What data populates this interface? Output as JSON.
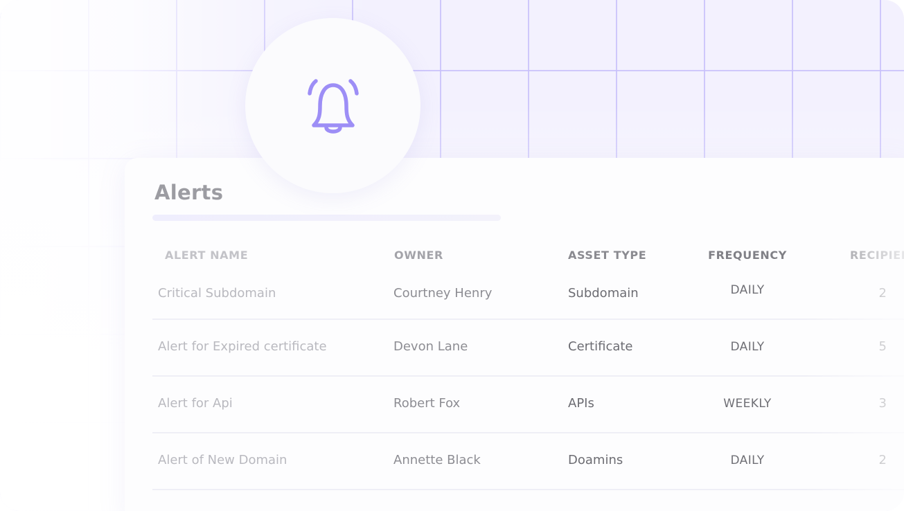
{
  "icon": {
    "name": "bell-icon",
    "color": "#9d8ef6"
  },
  "card": {
    "title": "Alerts"
  },
  "table": {
    "columns": [
      "ALERT NAME",
      "OWNER",
      "ASSET TYPE",
      "FREQUENCY",
      "RECIPIEN"
    ],
    "rows": [
      {
        "name": "Critical Subdomain",
        "owner": "Courtney Henry",
        "asset_type": "Subdomain",
        "frequency": "DAILY",
        "recipients": "2"
      },
      {
        "name": "Alert for Expired certificate",
        "owner": "Devon Lane",
        "asset_type": "Certificate",
        "frequency": "DAILY",
        "recipients": "5"
      },
      {
        "name": "Alert for Api",
        "owner": "Robert Fox",
        "asset_type": "APIs",
        "frequency": "WEEKLY",
        "recipients": "3"
      },
      {
        "name": "Alert of New Domain",
        "owner": "Annette Black",
        "asset_type": "Doamins",
        "frequency": "DAILY",
        "recipients": "2"
      }
    ]
  },
  "colors": {
    "grid_line": "#c8c0fa",
    "background": "#f3f1fe",
    "accent": "#9d8ef6"
  }
}
